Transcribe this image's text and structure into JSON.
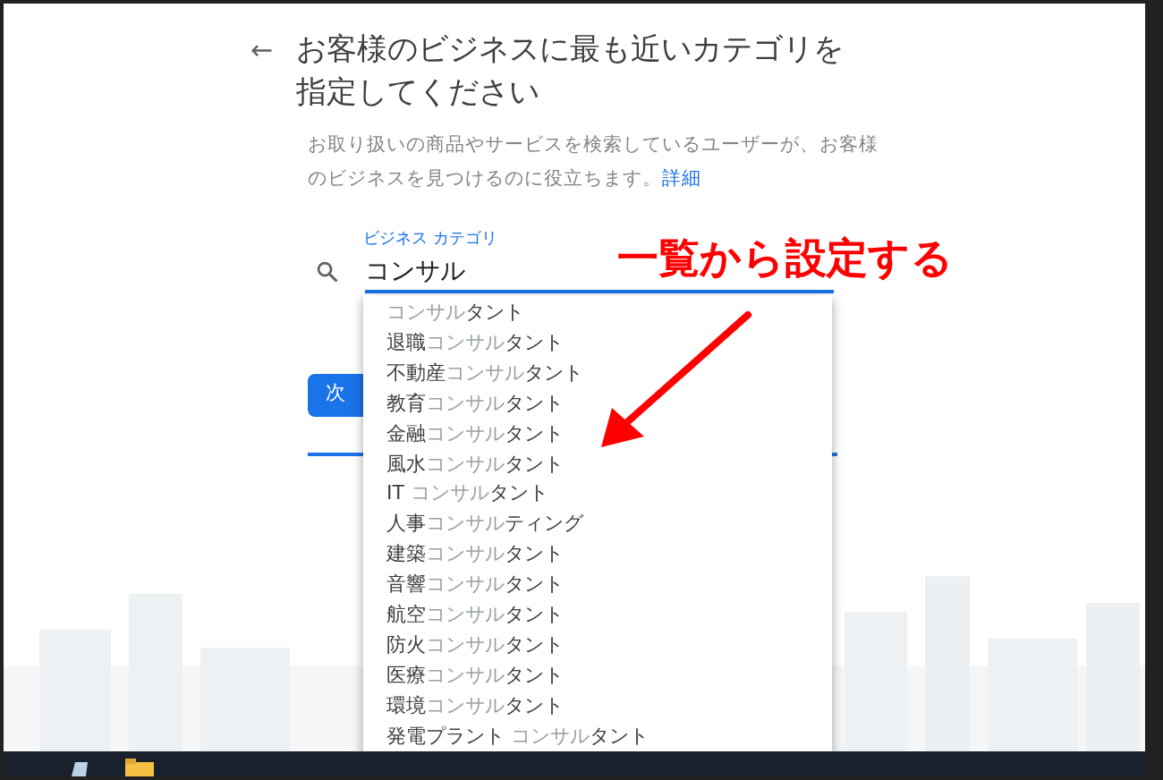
{
  "header": {
    "back": "←",
    "title": "お客様のビジネスに最も近いカテゴリを指定してください"
  },
  "description": {
    "text": "お取り扱いの商品やサービスを検索しているユーザーが、お客様のビジネスを見つけるのに役立ちます。",
    "link": "詳細"
  },
  "field": {
    "label": "ビジネス カテゴリ",
    "value": "コンサル",
    "focused": true
  },
  "suggestions": [
    {
      "text": "コンサル**タント**"
    },
    {
      "text": "**退職**コンサル**タント**"
    },
    {
      "text": "**不動産**コンサル**タント**"
    },
    {
      "text": "**教育**コンサル**タント**"
    },
    {
      "text": "**金融**コンサル**タント**"
    },
    {
      "text": "**風水**コンサル**タント**"
    },
    {
      "text": "**IT** コンサル**タント**"
    },
    {
      "text": "**人事**コンサル**ティング**"
    },
    {
      "text": "**建築**コンサル**タント**"
    },
    {
      "text": "**音響**コンサル**タント**"
    },
    {
      "text": "**航空**コンサル**タント**"
    },
    {
      "text": "**防火**コンサル**タント**"
    },
    {
      "text": "**医療**コンサル**タント**"
    },
    {
      "text": "**環境**コンサル**タント**"
    },
    {
      "text": "**発電プラント** コンサル**タント**"
    }
  ],
  "next_button": "次",
  "annotation": {
    "text": "一覧から設定する"
  }
}
